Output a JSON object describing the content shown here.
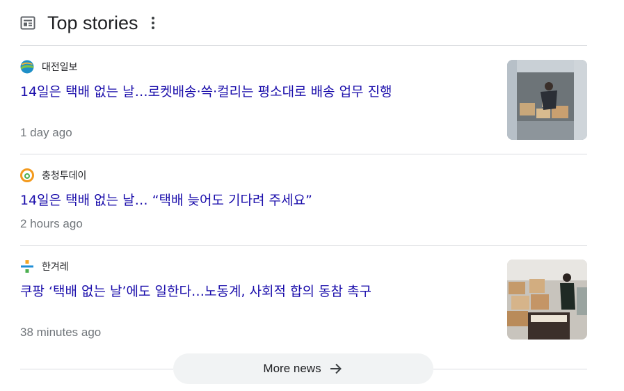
{
  "header": {
    "title": "Top stories",
    "icon": "news-icon",
    "menu_icon": "more-vert-icon"
  },
  "stories": [
    {
      "source": "대전일보",
      "source_logo": "globe-logo-icon",
      "headline": "14일은 택배 없는 날…로켓배송·쓱·컬리는 평소대로 배송 업무 진행",
      "time": "1 day ago",
      "has_thumbnail": true
    },
    {
      "source": "충청투데이",
      "source_logo": "circle-logo-icon",
      "headline": "14일은 택배 없는 날… “택배 늦어도 기다려 주세요”",
      "time": "2 hours ago",
      "has_thumbnail": false
    },
    {
      "source": "한겨레",
      "source_logo": "hani-logo-icon",
      "headline": "쿠팡 ‘택배 없는 날’에도 일한다…노동계, 사회적 합의 동참 촉구",
      "time": "38 minutes ago",
      "has_thumbnail": true
    }
  ],
  "more": {
    "label": "More news",
    "icon": "arrow-right-icon"
  },
  "colors": {
    "headline": "#1a0dab",
    "time": "#70757a",
    "divider": "#dadce0",
    "button_bg": "#f1f3f4"
  }
}
